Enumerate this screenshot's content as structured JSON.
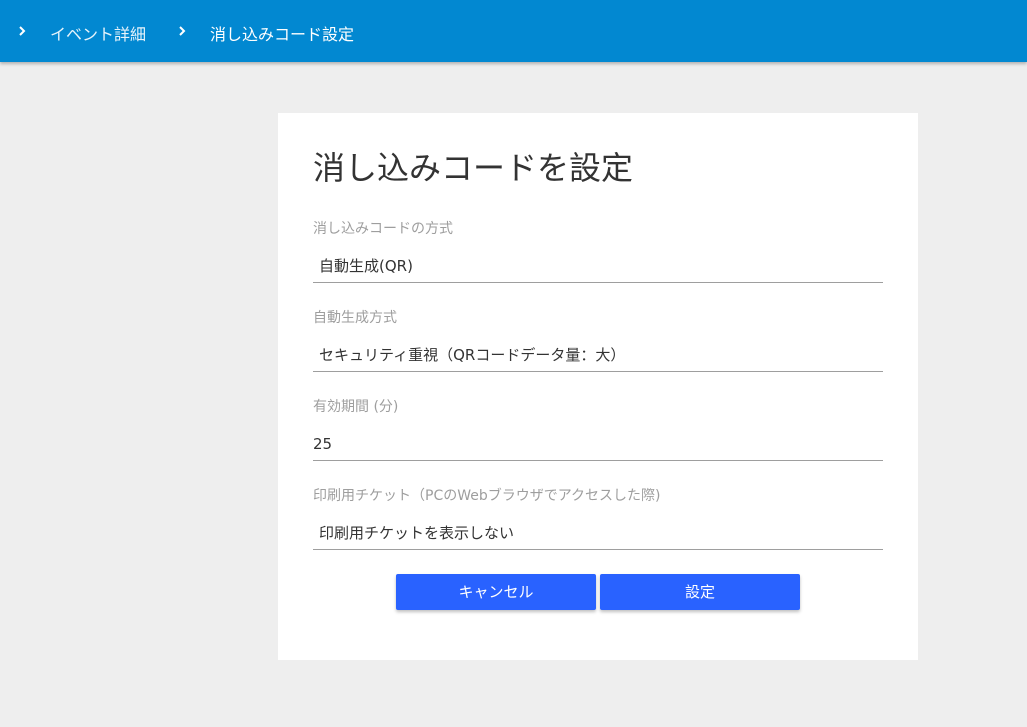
{
  "breadcrumb": {
    "items": [
      {
        "label": "イベント詳細",
        "icon": "chevron-right-icon"
      },
      {
        "label": "消し込みコード設定",
        "icon": "chevron-right-icon"
      }
    ]
  },
  "colors": {
    "app_bar": "#0288d1",
    "primary_button": "#2962ff",
    "page_background": "#eeeeee"
  },
  "form": {
    "title": "消し込みコードを設定",
    "fields": [
      {
        "label": "消し込みコードの方式",
        "value": "自動生成(QR)"
      },
      {
        "label": "自動生成方式",
        "value": "セキュリティ重視（QRコードデータ量：大）"
      },
      {
        "label": "有効期間 (分)",
        "value": "25"
      },
      {
        "label": "印刷用チケット（PCのWebブラウザでアクセスした際)",
        "value": "印刷用チケットを表示しない"
      }
    ],
    "cancel_label": "キャンセル",
    "submit_label": "設定"
  }
}
